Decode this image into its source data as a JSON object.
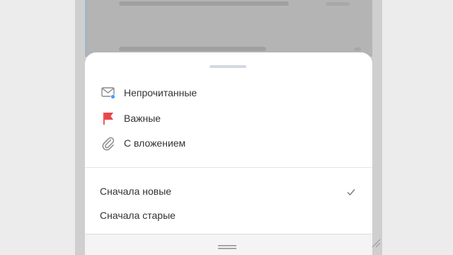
{
  "filters": [
    {
      "label": "Непрочитанные",
      "icon": "envelope-unread-icon"
    },
    {
      "label": "Важные",
      "icon": "flag-icon"
    },
    {
      "label": "С вложением",
      "icon": "paperclip-icon"
    }
  ],
  "sort_options": [
    {
      "label": "Сначала новые",
      "selected": true
    },
    {
      "label": "Сначала старые",
      "selected": false
    }
  ],
  "colors": {
    "unread_dot": "#4a9ff5",
    "flag": "#e8474b",
    "check": "#777777"
  }
}
